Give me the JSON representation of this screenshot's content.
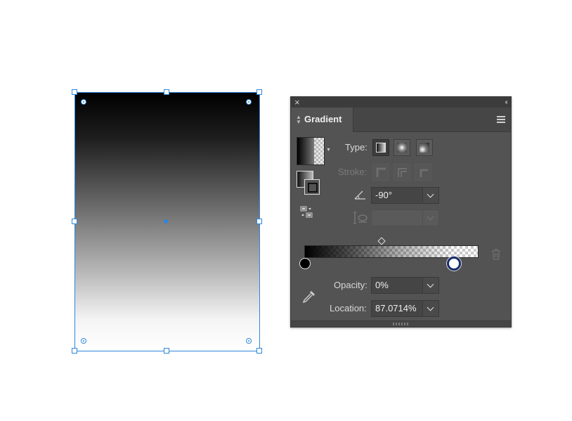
{
  "canvas": {
    "object_fill": "linear-gradient black to white (top to bottom)",
    "selection_color": "#2f86d9"
  },
  "panel": {
    "close_icon": "×",
    "collapse_icon": "‹‹",
    "tab_label": "Gradient",
    "type_label": "Type:",
    "stroke_label": "Stroke:",
    "angle_value": "-90°",
    "aspect_value": "",
    "opacity_label": "Opacity:",
    "opacity_value": "0%",
    "location_label": "Location:",
    "location_value": "87.0714%",
    "gradient_type_selected": "linear",
    "stops": [
      {
        "color": "#000000",
        "location_percent": 0
      },
      {
        "color": "#ffffff",
        "location_percent": 87.0714,
        "opacity_percent": 0,
        "selected": true
      }
    ],
    "midpoint_percent": 44,
    "colors": {
      "panel_bg": "#535353",
      "field_bg": "#454545",
      "selected_stop_ring": "#1a2c6b"
    }
  }
}
